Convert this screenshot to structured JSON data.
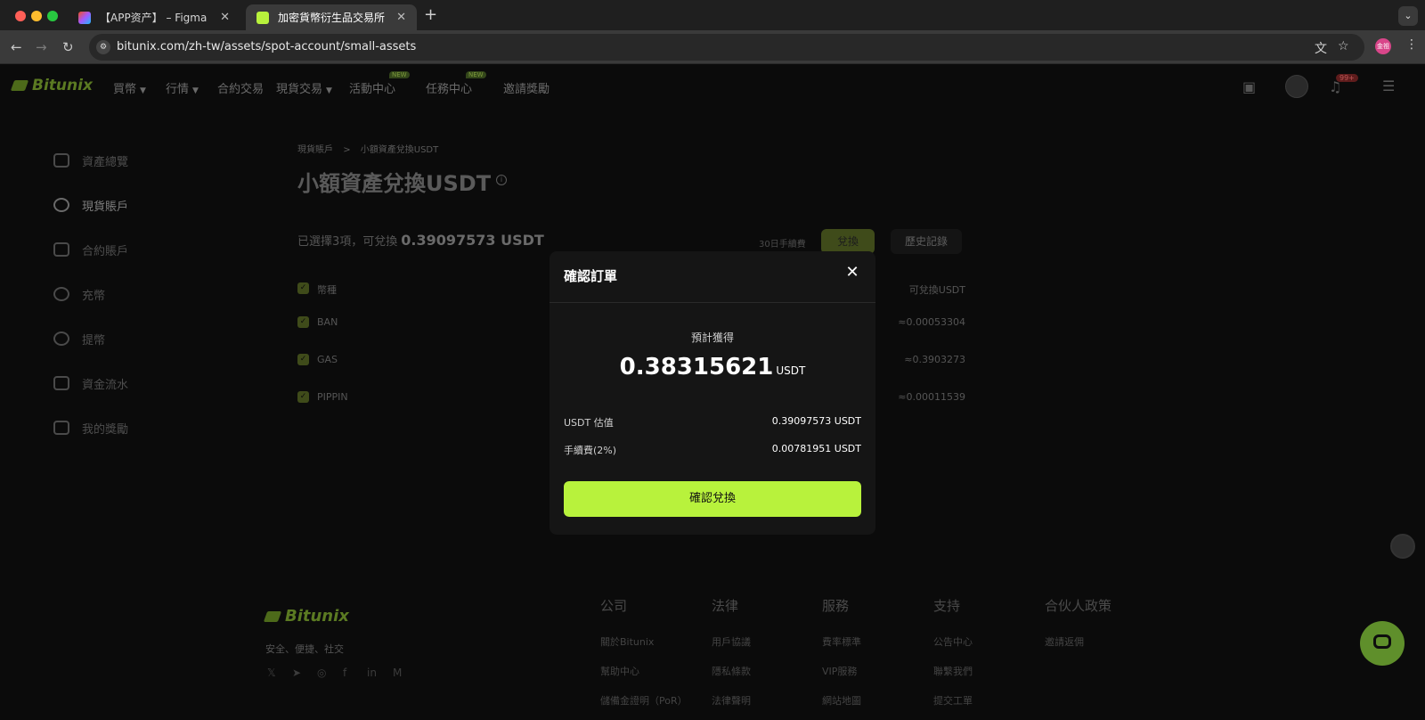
{
  "browser": {
    "tabs": [
      {
        "title": "【APP资产】 – Figma",
        "active": false
      },
      {
        "title": "加密貨幣衍生品交易所 | 購買,",
        "active": true
      }
    ],
    "url": "bitunix.com/zh-tw/assets/spot-account/small-assets",
    "profile_label": "金祖"
  },
  "site": {
    "logo": "Bitunix",
    "nav": [
      {
        "label": "買幣",
        "dropdown": true
      },
      {
        "label": "行情",
        "dropdown": true
      },
      {
        "label": "合約交易",
        "dropdown": false
      },
      {
        "label": "現貨交易",
        "dropdown": true
      },
      {
        "label": "活動中心",
        "badge": "NEW"
      },
      {
        "label": "任務中心",
        "badge": "NEW"
      },
      {
        "label": "邀請獎勵"
      }
    ],
    "notification_count": "99+"
  },
  "sidebar": {
    "items": [
      {
        "label": "資產總覽",
        "active": false
      },
      {
        "label": "現貨賬戶",
        "active": true
      },
      {
        "label": "合約賬戶",
        "active": false
      },
      {
        "label": "充幣",
        "active": false
      },
      {
        "label": "提幣",
        "active": false
      },
      {
        "label": "資金流水",
        "active": false
      },
      {
        "label": "我的獎勵",
        "active": false
      }
    ]
  },
  "main": {
    "breadcrumb": {
      "parent": "現貨賬戶",
      "separator": ">",
      "current": "小額資產兌換USDT"
    },
    "title": "小額資產兌換USDT",
    "summary_prefix": "已選擇3項，可兌換",
    "summary_amount": "0.39097573 USDT",
    "fee_rate": "30日手續費",
    "exchange_button": "兌換",
    "history_button": "歷史記錄",
    "table": {
      "header": {
        "name": "幣種",
        "value": "可兌換USDT"
      },
      "rows": [
        {
          "name": "BAN",
          "value": "≈0.00053304"
        },
        {
          "name": "GAS",
          "value": "≈0.3903273"
        },
        {
          "name": "PIPPIN",
          "value": "≈0.00011539"
        }
      ]
    }
  },
  "modal": {
    "title": "確認訂單",
    "est_label": "預計獲得",
    "est_amount": "0.38315621",
    "est_unit": "USDT",
    "rows": [
      {
        "label": "USDT 估值",
        "value": "0.39097573 USDT"
      },
      {
        "label": "手續費(2%)",
        "value": "0.00781951 USDT"
      }
    ],
    "confirm_button": "確認兌換"
  },
  "footer": {
    "logo": "Bitunix",
    "slogan": "安全、便捷、社交",
    "social_icons": [
      "x-icon",
      "telegram-icon",
      "instagram-icon",
      "facebook-icon",
      "linkedin-icon",
      "medium-icon"
    ],
    "columns": [
      {
        "heading": "公司",
        "links": [
          "關於Bitunix",
          "幫助中心",
          "儲備金證明（PoR）"
        ]
      },
      {
        "heading": "法律",
        "links": [
          "用戶協議",
          "隱私條款",
          "法律聲明"
        ]
      },
      {
        "heading": "服務",
        "links": [
          "費率標準",
          "VIP服務",
          "網站地圖"
        ]
      },
      {
        "heading": "支持",
        "links": [
          "公告中心",
          "聯繫我們",
          "提交工單"
        ]
      },
      {
        "heading": "合伙人政策",
        "links": [
          "邀請返佣"
        ]
      }
    ]
  }
}
